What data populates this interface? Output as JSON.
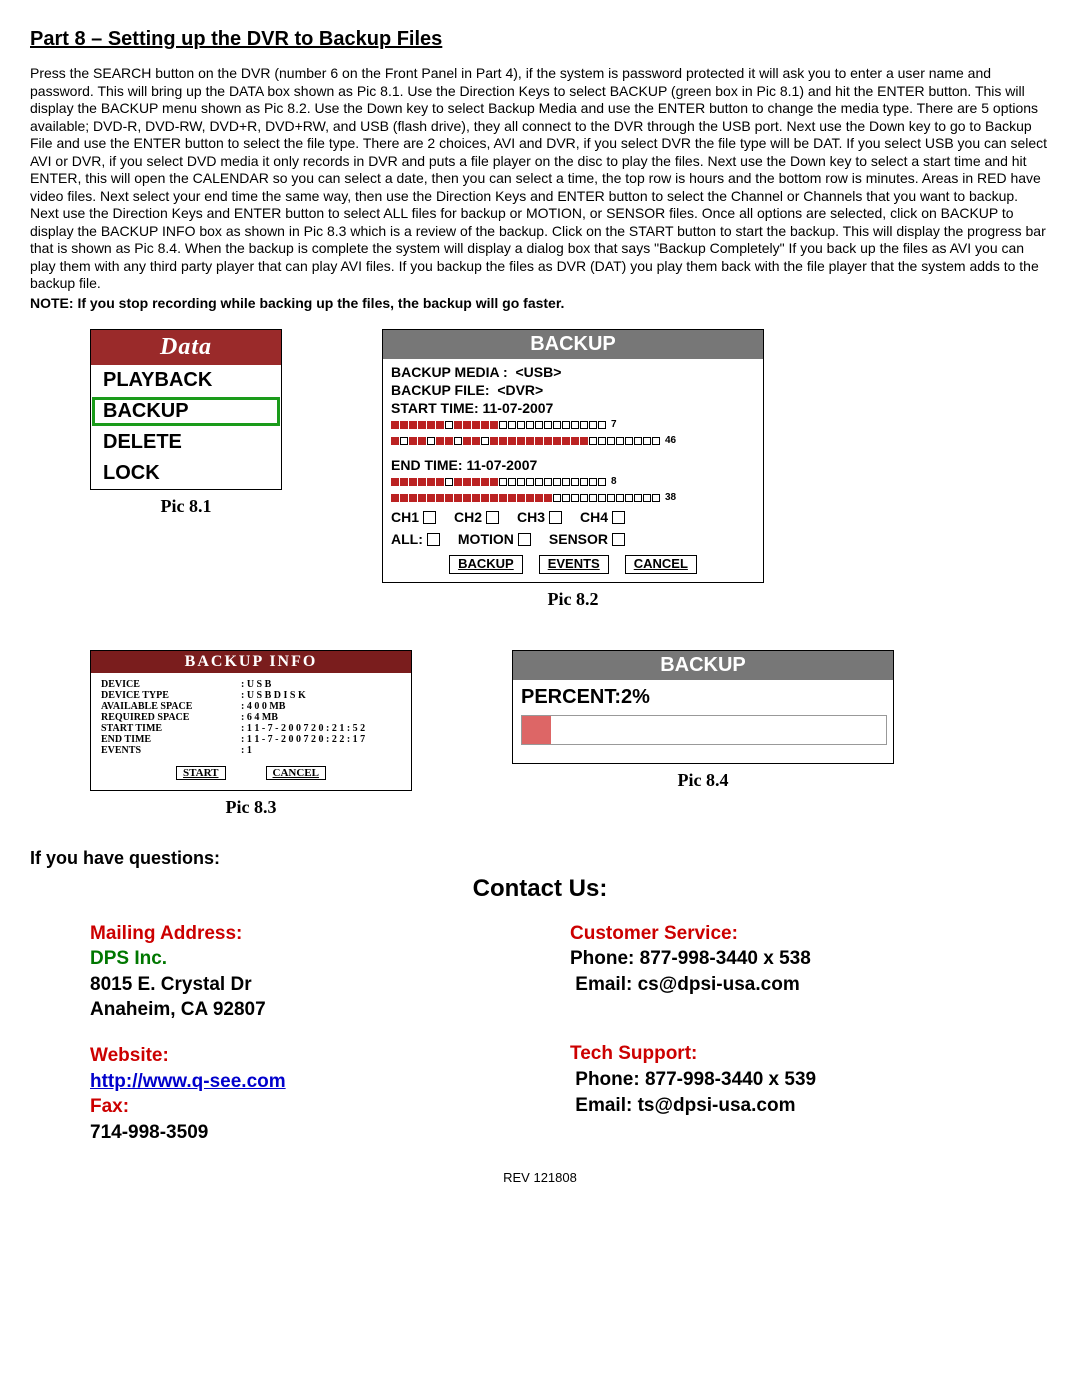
{
  "heading": "Part 8 – Setting up the DVR to Backup Files",
  "body_text": "Press the SEARCH button on the DVR (number 6 on the Front Panel in Part 4), if the system is password protected it will ask you to enter a user name and password. This will bring up the DATA box shown as Pic 8.1. Use the Direction Keys to select BACKUP (green box in Pic 8.1) and hit the ENTER button. This will display the BACKUP menu shown as Pic 8.2. Use the Down key to select Backup Media and use the ENTER button to change the media type. There are 5 options available; DVD-R, DVD-RW, DVD+R, DVD+RW, and USB (flash drive), they all connect to the DVR through the USB port. Next use the Down key to go to Backup File and use the ENTER button to select the file type. There are 2 choices, AVI and DVR, if you select DVR the file type will be DAT. If you select USB you can select AVI or DVR, if you select DVD media it only records in DVR and puts a file player on the disc to play the files. Next use the Down key to select a start time and hit ENTER, this will open the CALENDAR so you can select a date, then you can select a time, the top row is hours and the bottom row is minutes.  Areas in RED have video files. Next select your end time the same way, then use the Direction Keys and ENTER button to select the Channel or Channels that you want to backup. Next use the Direction Keys and ENTER button to select ALL files for backup or MOTION, or SENSOR files. Once all options are selected, click on BACKUP to display the BACKUP INFO box as shown in Pic 8.3 which is a review of the backup. Click on the START button to start the backup. This will display the progress bar that is shown as Pic 8.4. When the backup is complete the system will display a dialog box that says \"Backup Completely\" If you back up the files as AVI you can play them with any third party player that can play AVI files. If you backup the files as DVR (DAT) you play them back with the file player that the system adds to the backup file.",
  "note": "NOTE: If you stop recording while backing up the files, the backup will go faster.",
  "pic81": {
    "title": "Data",
    "items": [
      "PLAYBACK",
      "BACKUP",
      "DELETE",
      "LOCK"
    ],
    "selected": 1,
    "caption": "Pic 8.1"
  },
  "pic82": {
    "title": "BACKUP",
    "media_label": "BACKUP MEDIA :",
    "media_value": "<USB>",
    "file_label": "BACKUP FILE:",
    "file_value": "<DVR>",
    "start_label": "START TIME: 11-07-2007",
    "start_tail": "7",
    "start_tail2": "46",
    "end_label": "END     TIME: 11-07-2007",
    "end_tail": "8",
    "end_tail2": "38",
    "ch_row": [
      "CH1",
      "CH2",
      "CH3",
      "CH4"
    ],
    "all_row": [
      "ALL:",
      "MOTION",
      "SENSOR"
    ],
    "buttons": [
      "BACKUP",
      "EVENTS",
      "CANCEL"
    ],
    "caption": "Pic 8.2"
  },
  "pic83": {
    "title": "BACKUP   INFO",
    "rows": [
      [
        "DEVICE",
        ": U S B"
      ],
      [
        "DEVICE   TYPE",
        ": U S B   D I S K"
      ],
      [
        "AVAILABLE SPACE",
        ": 4 0 0 MB"
      ],
      [
        "REQUIRED SPACE",
        ": 6 4 MB"
      ],
      [
        "START   TIME",
        ": 1 1 - 7 - 2 0 0 7   2 0 : 2 1 : 5 2"
      ],
      [
        "END     TIME",
        ": 1 1 - 7 - 2 0 0 7   2 0 : 2 2 : 1 7"
      ],
      [
        "EVENTS",
        ": 1"
      ]
    ],
    "buttons": [
      "START",
      "CANCEL"
    ],
    "caption": "Pic 8.3"
  },
  "pic84": {
    "title": "BACKUP",
    "percent_label": "PERCENT:2%",
    "caption": "Pic 8.4"
  },
  "questions": "If you have questions:",
  "contact_title": "Contact Us:",
  "contact": {
    "left": {
      "mailing_hdr": "Mailing Address:",
      "company": "DPS Inc.",
      "street": "8015 E. Crystal Dr",
      "city": "Anaheim, CA 92807",
      "website_hdr": "Website:",
      "website_url": "http://www.q-see.com",
      "fax_hdr": "Fax:",
      "fax_num": "714-998-3509"
    },
    "right": {
      "cs_hdr": "Customer Service:",
      "cs_phone": "Phone: 877-998-3440 x 538",
      "cs_email": "Email: cs@dpsi-usa.com",
      "ts_hdr": "Tech Support:",
      "ts_phone": "Phone: 877-998-3440 x 539",
      "ts_email": "Email: ts@dpsi-usa.com"
    }
  },
  "rev": "REV 121808"
}
